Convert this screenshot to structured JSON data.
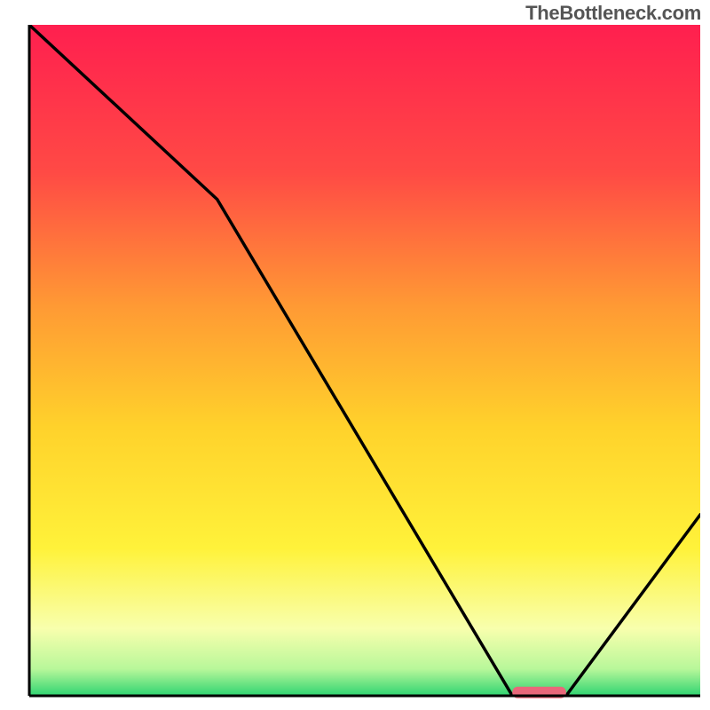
{
  "watermark": "TheBottleneck.com",
  "chart_data": {
    "type": "line",
    "title": "",
    "xlabel": "",
    "ylabel": "",
    "xlim": [
      0,
      100
    ],
    "ylim": [
      0,
      100
    ],
    "series": [
      {
        "name": "bottleneck-curve",
        "x": [
          0,
          28,
          72,
          80,
          100
        ],
        "y": [
          100,
          74,
          0,
          0,
          27
        ]
      }
    ],
    "marker": {
      "name": "sweet-spot",
      "x_range": [
        72,
        80
      ],
      "y": 0.5,
      "color": "#e9677a"
    },
    "background_gradient": {
      "top": "#ff1f4f",
      "upper_mid": "#ff6a3d",
      "mid": "#ffc229",
      "lower_mid": "#fff23a",
      "pale": "#fbffb8",
      "bottom": "#2fd471"
    },
    "axes_color": "#000000"
  }
}
